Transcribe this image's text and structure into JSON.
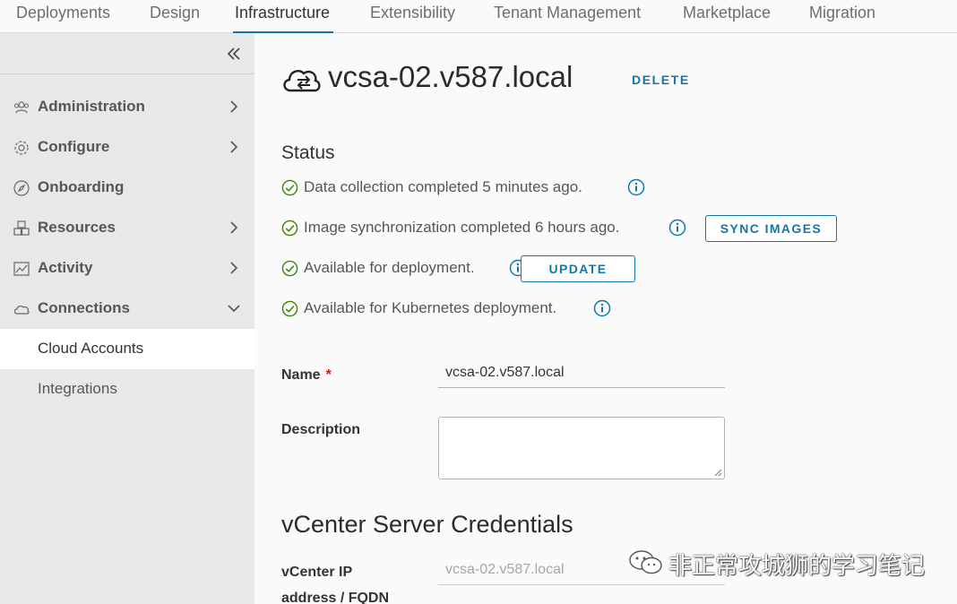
{
  "topnav": {
    "tabs": [
      {
        "label": "Deployments"
      },
      {
        "label": "Design"
      },
      {
        "label": "Infrastructure"
      },
      {
        "label": "Extensibility"
      },
      {
        "label": "Tenant Management"
      },
      {
        "label": "Marketplace"
      },
      {
        "label": "Migration"
      }
    ],
    "active_tab": "Infrastructure"
  },
  "sidebar": {
    "collapse_icon": "double-chevron-left-icon",
    "items": [
      {
        "label": "Administration",
        "icon": "users-icon",
        "expandable": true,
        "expanded": false
      },
      {
        "label": "Configure",
        "icon": "gear-icon",
        "expandable": true,
        "expanded": false
      },
      {
        "label": "Onboarding",
        "icon": "compass-icon",
        "expandable": false
      },
      {
        "label": "Resources",
        "icon": "cubes-icon",
        "expandable": true,
        "expanded": false
      },
      {
        "label": "Activity",
        "icon": "line-chart-icon",
        "expandable": true,
        "expanded": false
      },
      {
        "label": "Connections",
        "icon": "cloud-icon",
        "expandable": true,
        "expanded": true
      }
    ],
    "subitems": [
      {
        "label": "Cloud Accounts",
        "selected": true
      },
      {
        "label": "Integrations",
        "selected": false
      }
    ]
  },
  "main": {
    "title": "vcsa-02.v587.local",
    "title_icon": "cloud-sync-icon",
    "delete_label": "DELETE",
    "status_heading": "Status",
    "status": [
      {
        "text": "Data collection completed 5 minutes ago.",
        "icon": "check-circle-icon"
      },
      {
        "text": "Image synchronization completed 6 hours ago.",
        "icon": "check-circle-icon",
        "button": "SYNC IMAGES"
      },
      {
        "text": "Available for deployment.",
        "icon": "check-circle-icon",
        "button": "UPDATE"
      },
      {
        "text": "Available for Kubernetes deployment.",
        "icon": "check-circle-icon"
      }
    ],
    "form": {
      "name_label": "Name",
      "required_mark": "*",
      "name_value": "vcsa-02.v587.local",
      "description_label": "Description",
      "description_value": "",
      "credentials_heading": "vCenter Server Credentials",
      "ip_label_line1": "vCenter IP",
      "ip_label_line2": "address / FQDN",
      "ip_value": "vcsa-02.v587.local"
    }
  },
  "watermark": {
    "text": "非正常攻城狮的学习笔记"
  },
  "colors": {
    "accent": "#1477a8",
    "success": "#3c8500",
    "required": "#c92100",
    "sidebar_bg": "#e8e8e8"
  }
}
